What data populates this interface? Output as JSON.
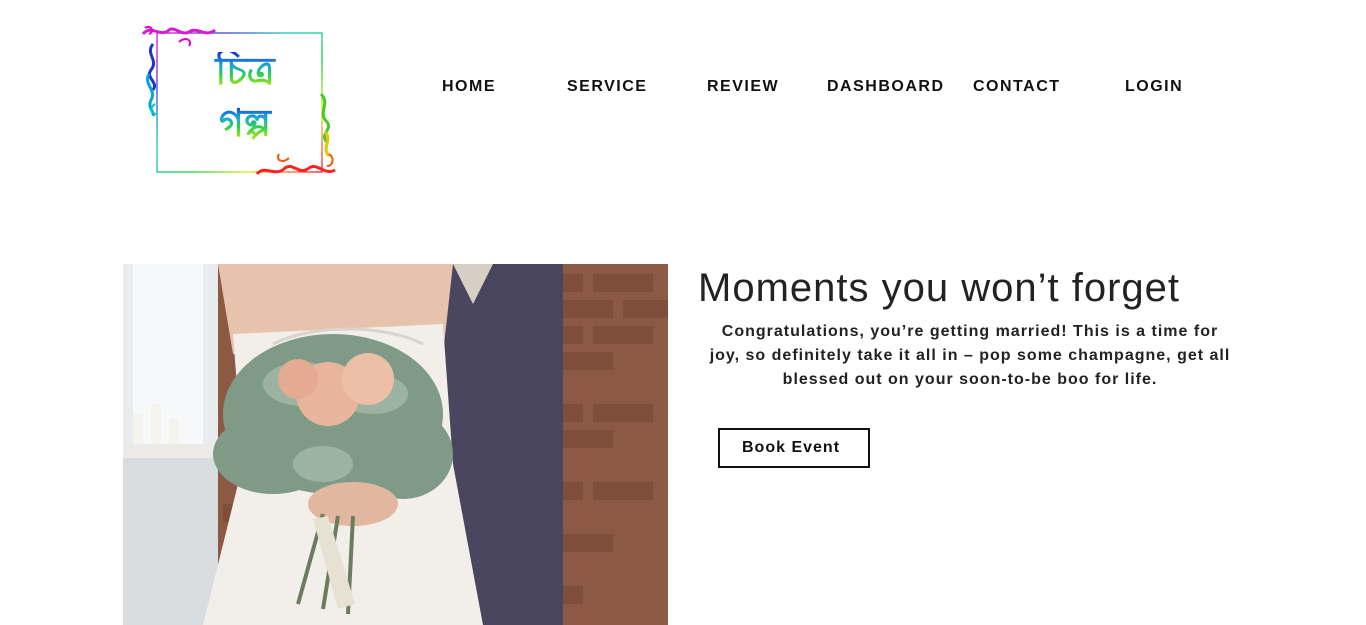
{
  "logo": {
    "text_line1": "চিত্র",
    "text_line2": "গল্প",
    "frame_colors": [
      "#e600c8",
      "#0033cc",
      "#00c8c8",
      "#00cc33",
      "#e6e600",
      "#ff8800",
      "#ff0033"
    ]
  },
  "nav": {
    "items": [
      {
        "label": "HOME"
      },
      {
        "label": "SERVICE"
      },
      {
        "label": "REVIEW"
      },
      {
        "label": "DASHBOARD"
      },
      {
        "label": "CONTACT"
      },
      {
        "label": "LOGIN"
      }
    ]
  },
  "hero": {
    "image_icon": "wedding-couple-photo",
    "title": "Moments you won’t forget",
    "body": "Congratulations, you’re getting married! This is a time for joy, so definitely take it all in – pop some champagne, get all blessed out on your soon-to-be boo for life.",
    "button_label": "Book Event"
  }
}
